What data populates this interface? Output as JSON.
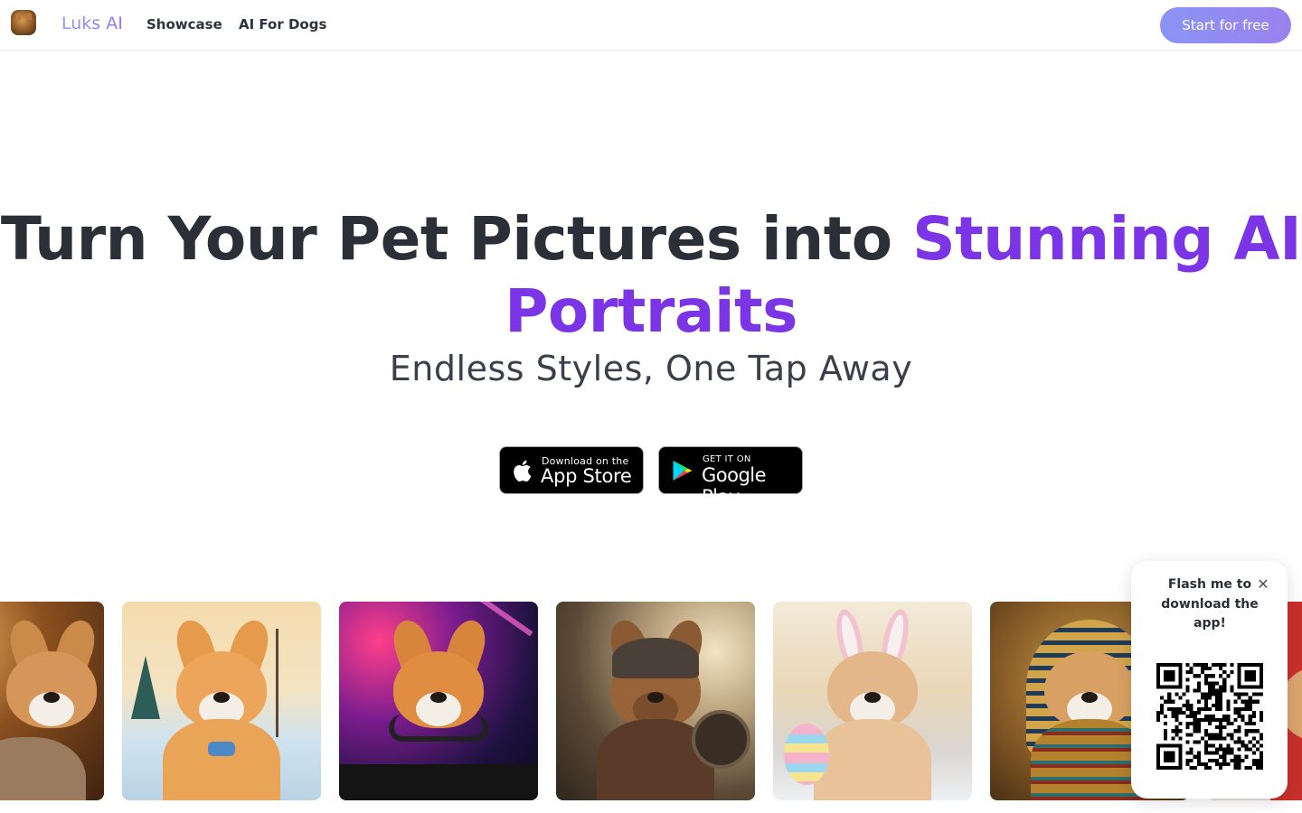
{
  "header": {
    "brand": "Luks AI",
    "nav": [
      {
        "label": "Showcase"
      },
      {
        "label": "AI For Dogs"
      }
    ],
    "cta_label": "Start for free"
  },
  "hero": {
    "title_plain": "Turn Your Pet Pictures into ",
    "title_accent_line1": "Stunning AI",
    "title_accent_line2": "Portraits",
    "subtitle": "Endless Styles, One Tap Away",
    "accent_color": "#7c35e6"
  },
  "badges": {
    "apple": {
      "small": "Download on the",
      "big": "App Store",
      "icon": "apple-icon"
    },
    "google": {
      "small": "GET IT ON",
      "big": "Google Play",
      "icon": "google-play-icon"
    }
  },
  "gallery": {
    "tiles": [
      {
        "name": "corgi-cozy-bed"
      },
      {
        "name": "corgi-cartoon-winter"
      },
      {
        "name": "corgi-dj-party"
      },
      {
        "name": "corgi-viking-warrior"
      },
      {
        "name": "corgi-easter-bunny"
      },
      {
        "name": "corgi-pharaoh"
      },
      {
        "name": "corgi-red-costume"
      }
    ]
  },
  "qr_popup": {
    "text": "Flash me to download the app!",
    "close_icon": "close-icon"
  }
}
